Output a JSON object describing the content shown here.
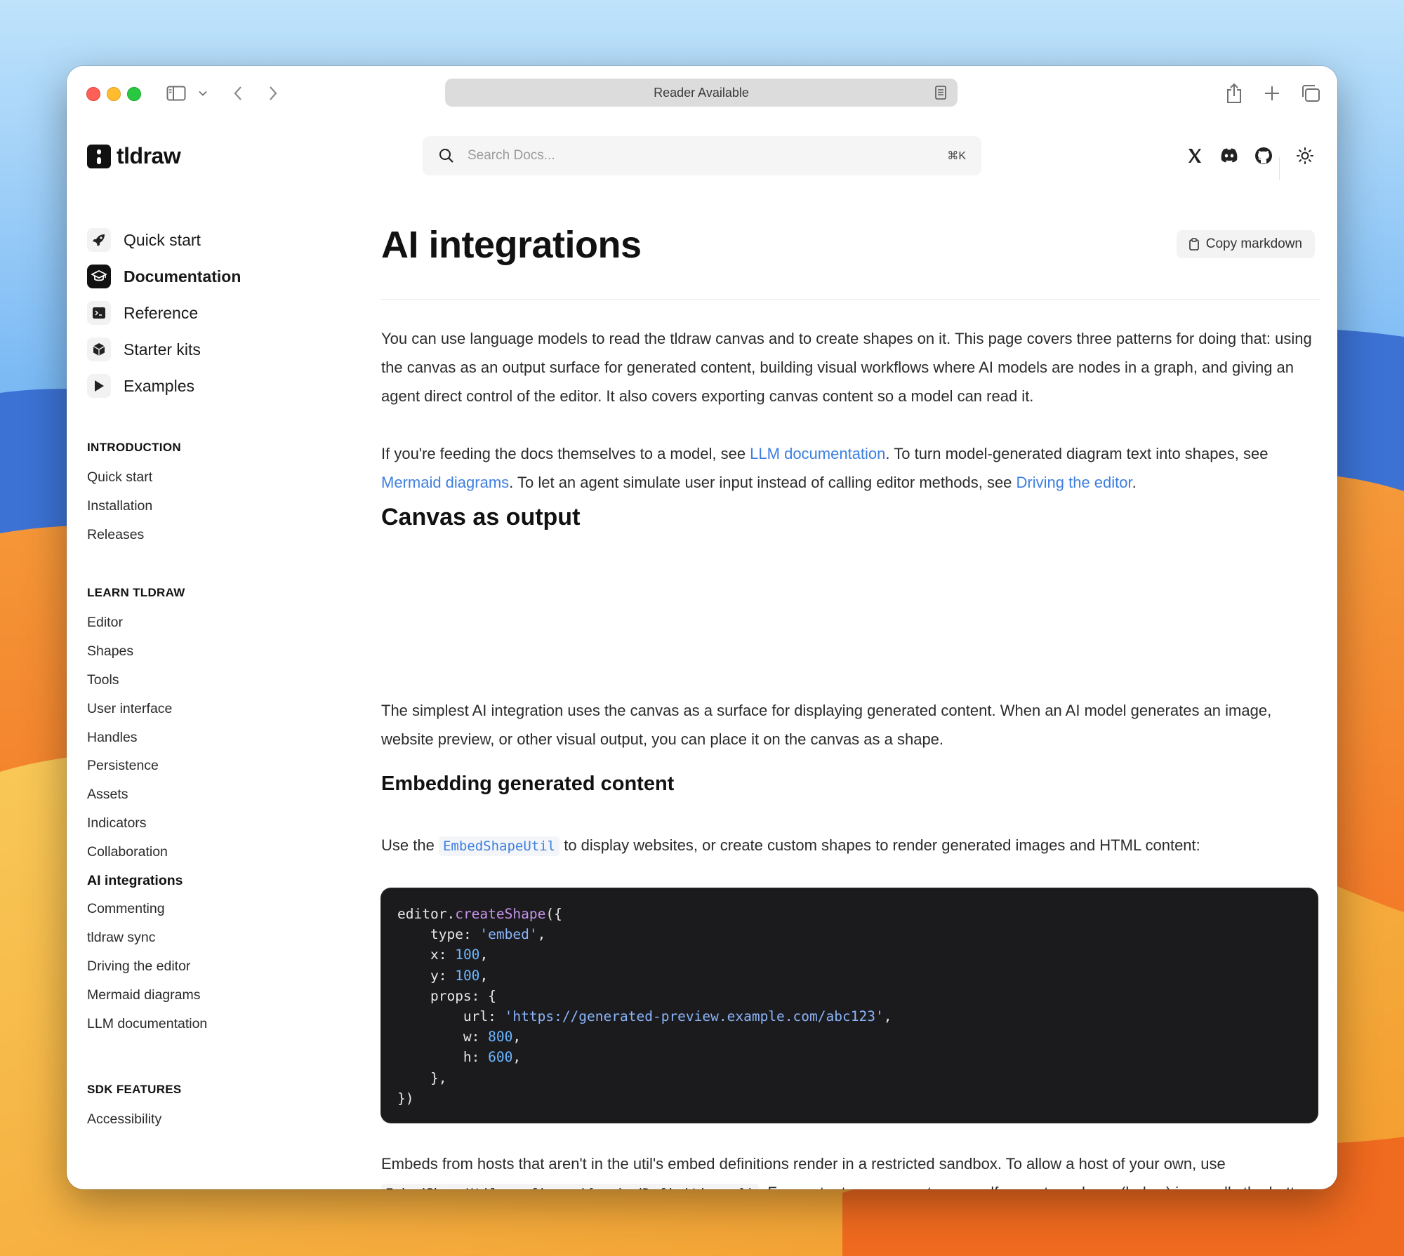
{
  "browser": {
    "address_text": "Reader Available"
  },
  "site": {
    "logo_text": "tldraw",
    "search_placeholder": "Search Docs...",
    "search_shortcut": "⌘K"
  },
  "primary_nav": [
    {
      "label": "Quick start",
      "icon": "rocket-icon"
    },
    {
      "label": "Documentation",
      "icon": "graduation-cap-icon"
    },
    {
      "label": "Reference",
      "icon": "terminal-icon"
    },
    {
      "label": "Starter kits",
      "icon": "box-icon"
    },
    {
      "label": "Examples",
      "icon": "play-icon"
    }
  ],
  "sections": [
    {
      "title": "INTRODUCTION",
      "items": [
        "Quick start",
        "Installation",
        "Releases"
      ]
    },
    {
      "title": "LEARN TLDRAW",
      "items": [
        "Editor",
        "Shapes",
        "Tools",
        "User interface",
        "Handles",
        "Persistence",
        "Assets",
        "Indicators",
        "Collaboration",
        "AI integrations",
        "Commenting",
        "tldraw sync",
        "Driving the editor",
        "Mermaid diagrams",
        "LLM documentation"
      ]
    },
    {
      "title": "SDK FEATURES",
      "items": [
        "Accessibility"
      ]
    }
  ],
  "active_nav_item": "AI integrations",
  "page": {
    "title": "AI integrations",
    "copy_button": "Copy markdown",
    "intro": "You can use language models to read the tldraw canvas and to create shapes on it. This page covers three patterns for doing that: using the canvas as an output surface for generated content, building visual workflows where AI models are nodes in a graph, and giving an agent direct control of the editor. It also covers exporting canvas content so a model can read it.",
    "p2_a": "If you're feeding the docs themselves to a model, see ",
    "p2_link1": "LLM documentation",
    "p2_b": ". To turn model-generated diagram text into shapes, see ",
    "p2_link2": "Mermaid diagrams",
    "p2_c": ". To let an agent simulate user input instead of calling editor methods, see ",
    "p2_link3": "Driving the editor",
    "p2_d": ".",
    "h2_canvas": "Canvas as output",
    "canvas_para": "The simplest AI integration uses the canvas as a surface for displaying generated content. When an AI model generates an image, website preview, or other visual output, you can place it on the canvas as a shape.",
    "h3_embed": "Embedding generated content",
    "embed_a": "Use the ",
    "embed_code": "EmbedShapeUtil",
    "embed_b": " to display websites, or create custom shapes to render generated images and HTML content:",
    "code": {
      "obj": "editor",
      "fn": "createShape",
      "type_val": "'embed'",
      "x_val": "100",
      "y_val": "100",
      "url_val": "'https://generated-preview.example.com/abc123'",
      "w_val": "800",
      "h_val": "600"
    },
    "last_a": "Embeds from hosts that aren't in the util's embed definitions render in a restricted sandbox. To allow a host of your own, use ",
    "last_code": "EmbedShapeUtil.configure({ embedDefinitions })",
    "last_b": ". For content you generate yourself, a custom shape (below) is usually the better fit."
  }
}
